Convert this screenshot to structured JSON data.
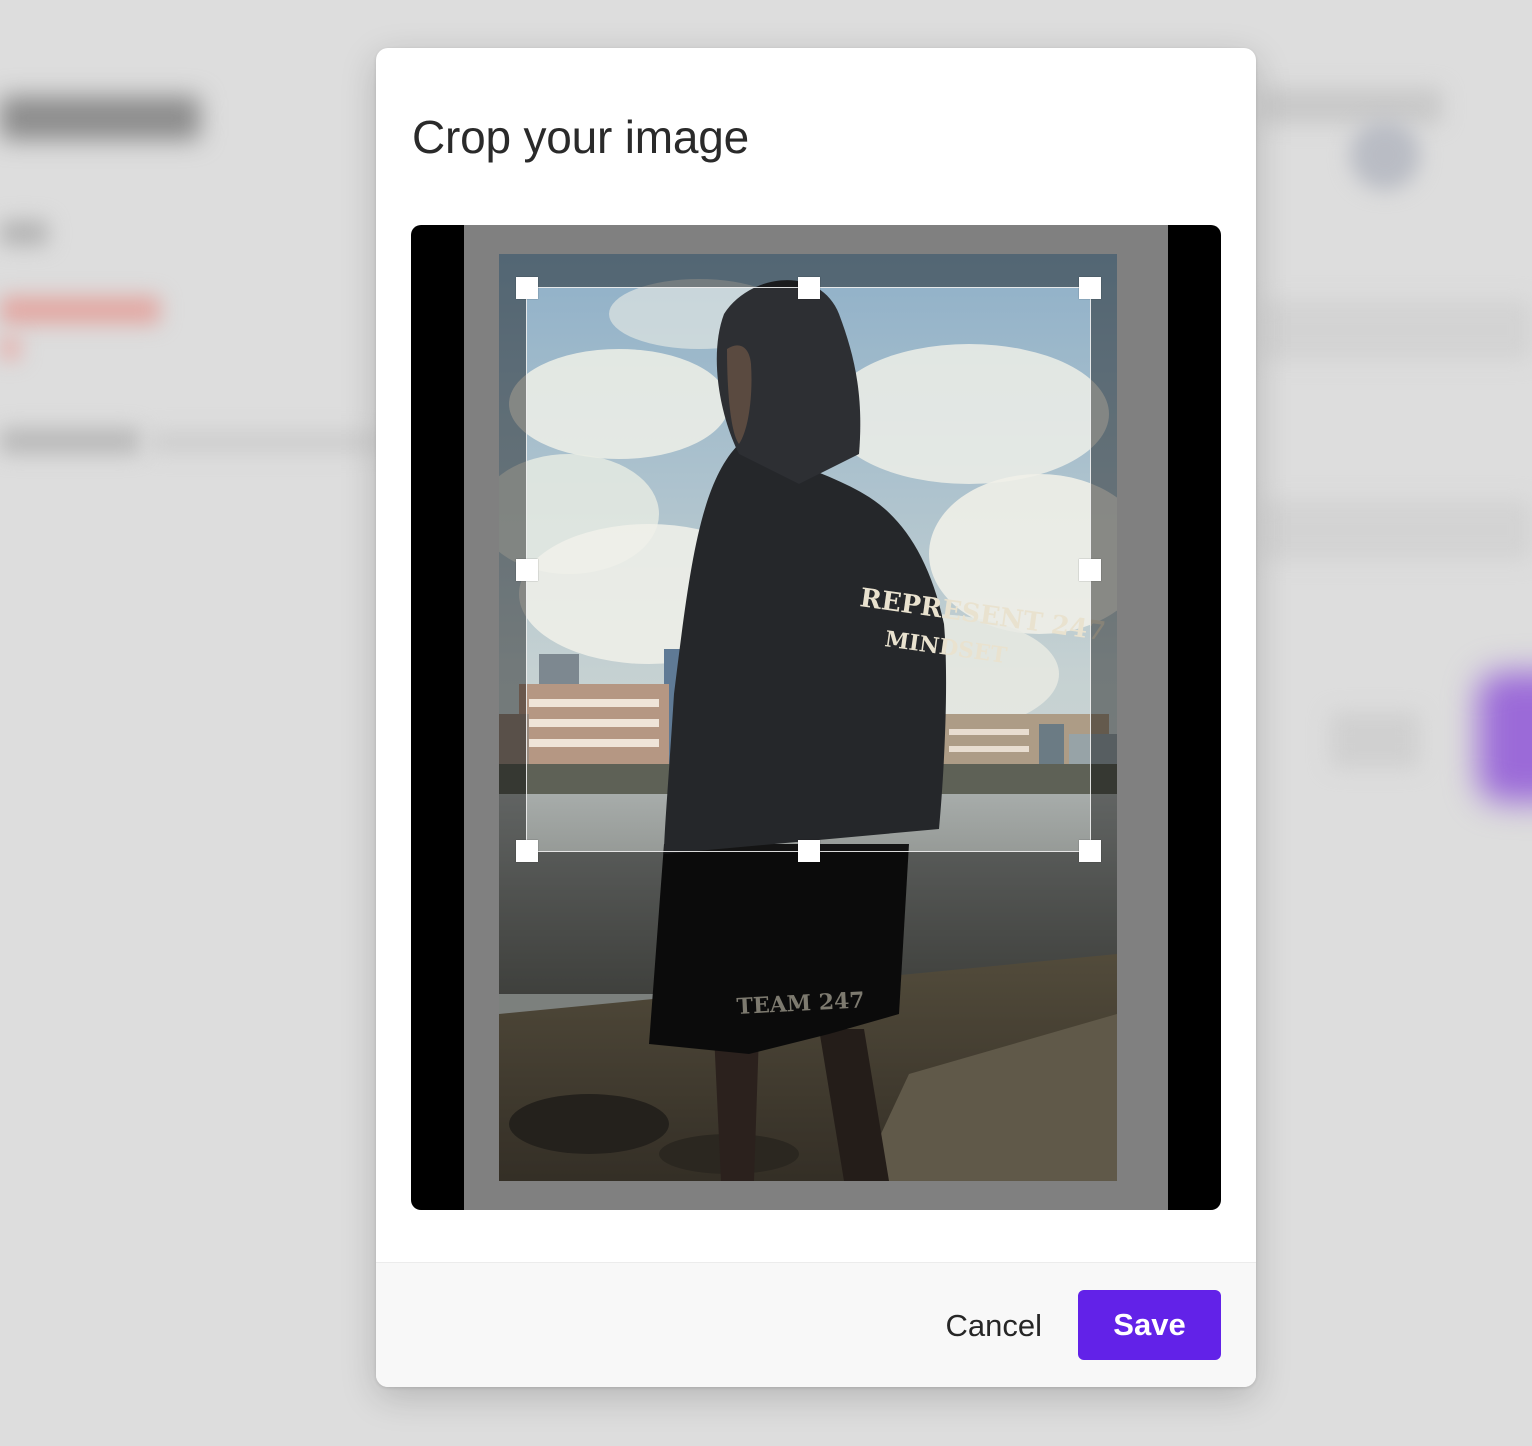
{
  "dialog": {
    "title": "Crop your image"
  },
  "crop": {
    "image_alt": "Person in a dark hoodie standing by a river",
    "hoodie_print": [
      "REPRESENT 247",
      "MINDSET"
    ],
    "shorts_print": "TEAM 247"
  },
  "footer": {
    "cancel_label": "Cancel",
    "save_label": "Save"
  },
  "colors": {
    "primary": "#6222e8",
    "overlay": "#808080",
    "stage": "#000000"
  }
}
